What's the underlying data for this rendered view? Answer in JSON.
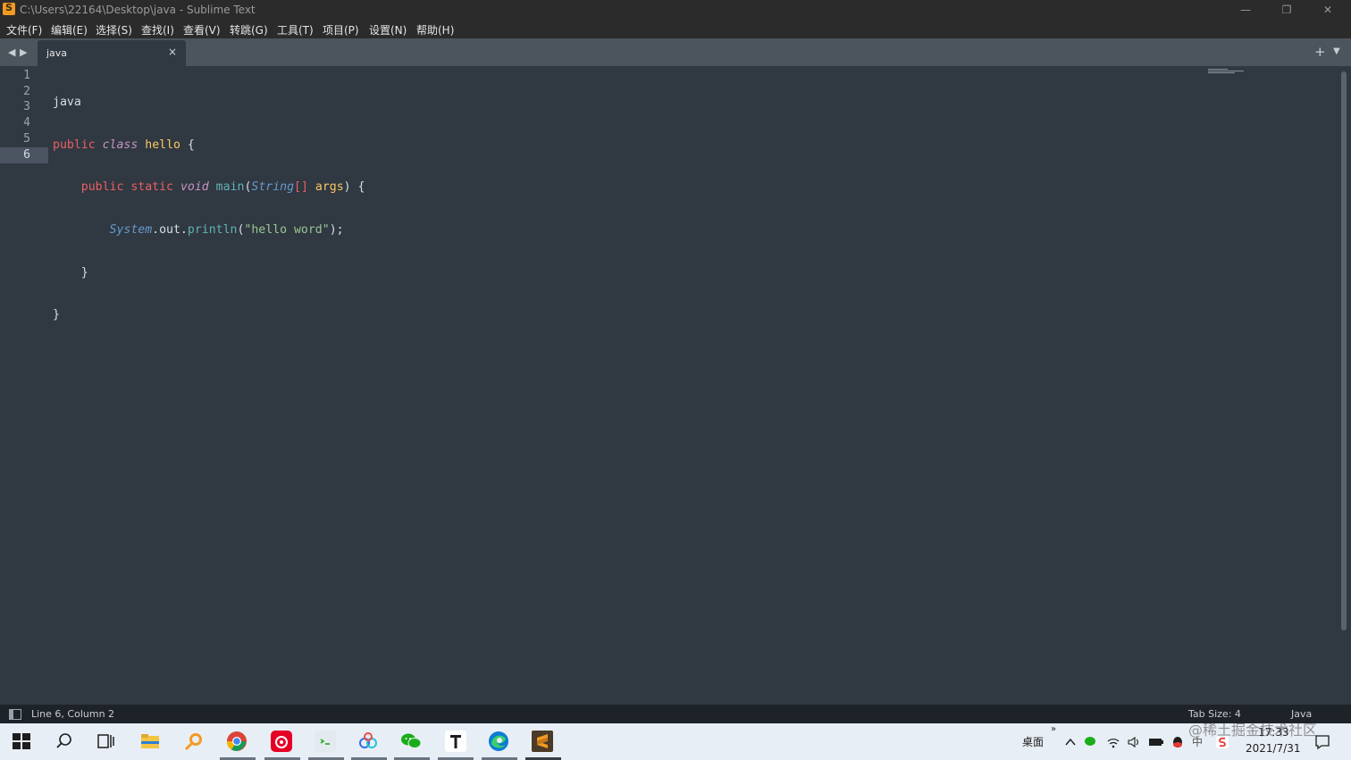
{
  "window": {
    "title": "C:\\Users\\22164\\Desktop\\java - Sublime Text",
    "controls": {
      "minimize": "—",
      "restore": "❐",
      "close": "✕"
    }
  },
  "menu": [
    "文件(F)",
    "编辑(E)",
    "选择(S)",
    "查找(I)",
    "查看(V)",
    "转跳(G)",
    "工具(T)",
    "项目(P)",
    "设置(N)",
    "帮助(H)"
  ],
  "tabs": [
    {
      "label": "java",
      "close": "×",
      "active": true
    }
  ],
  "tab_strip": {
    "prev": "◀",
    "next": "▶",
    "new_tab": "+",
    "more": "▼"
  },
  "editor": {
    "line_numbers": [
      "1",
      "2",
      "3",
      "4",
      "5",
      "6"
    ],
    "active_line": 6,
    "tokens": {
      "l1": "java",
      "l2_public": "public",
      "l2_class": "class",
      "l2_name": "hello",
      "l2_brace": " {",
      "l3_public": "public",
      "l3_static": "static",
      "l3_void": "void",
      "l3_main": "main",
      "l3_string": "String",
      "l3_brackets": "[]",
      "l3_args": "args",
      "l3_tail": ") {",
      "l4_system": "System",
      "l4_out": ".out.",
      "l4_println": "println",
      "l4_str": "\"hello word\"",
      "l4_tail": ");",
      "l5": "}",
      "l6": "}"
    }
  },
  "status": {
    "position": "Line 6, Column 2",
    "tab_size": "Tab Size: 4",
    "syntax": "Java"
  },
  "taskbar": {
    "tray_label": "桌面",
    "overflow": "»",
    "time": "17:33",
    "date": "2021/7/31",
    "ime": "中",
    "watermark": "@稀土掘金技术社区"
  },
  "colors": {
    "editor_bg": "#303841",
    "keyword": "#ec5f67",
    "storage": "#f99157",
    "type": "#c594c5",
    "class_name": "#fac863",
    "function": "#5fb3b3",
    "string": "#99c794",
    "sublime_orange": "#f29a22"
  }
}
